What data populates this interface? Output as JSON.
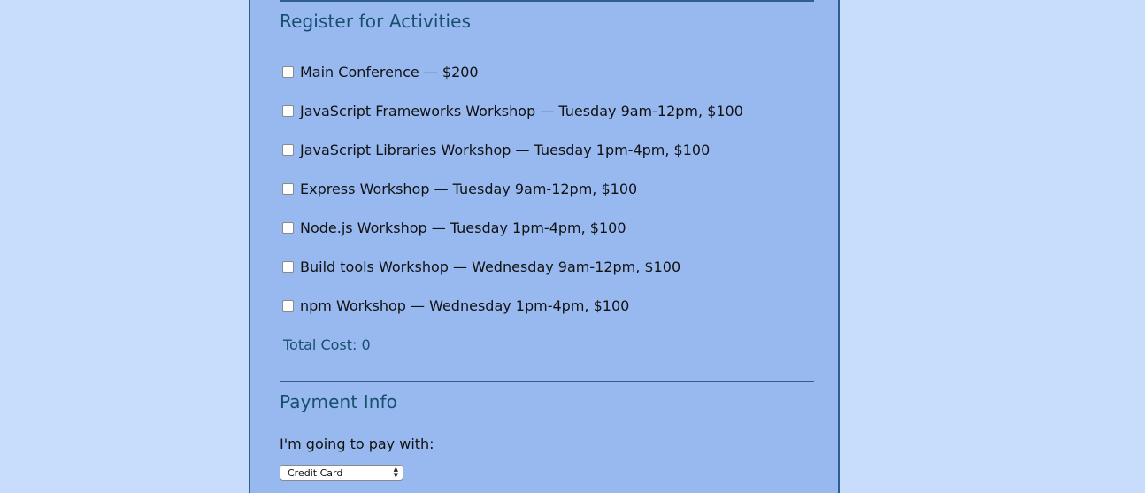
{
  "activities": {
    "title": "Register for Activities",
    "items": [
      {
        "label": "Main Conference — $200",
        "checked": false
      },
      {
        "label": "JavaScript Frameworks Workshop — Tuesday 9am-12pm, $100",
        "checked": false
      },
      {
        "label": "JavaScript Libraries Workshop — Tuesday 1pm-4pm, $100",
        "checked": false
      },
      {
        "label": "Express Workshop — Tuesday 9am-12pm, $100",
        "checked": false
      },
      {
        "label": "Node.js Workshop — Tuesday 1pm-4pm, $100",
        "checked": false
      },
      {
        "label": "Build tools Workshop — Wednesday 9am-12pm, $100",
        "checked": false
      },
      {
        "label": "npm Workshop — Wednesday 1pm-4pm, $100",
        "checked": false
      }
    ],
    "total_label": "Total Cost: 0"
  },
  "payment": {
    "title": "Payment Info",
    "label": "I'm going to pay with:",
    "selected": "Credit Card"
  }
}
